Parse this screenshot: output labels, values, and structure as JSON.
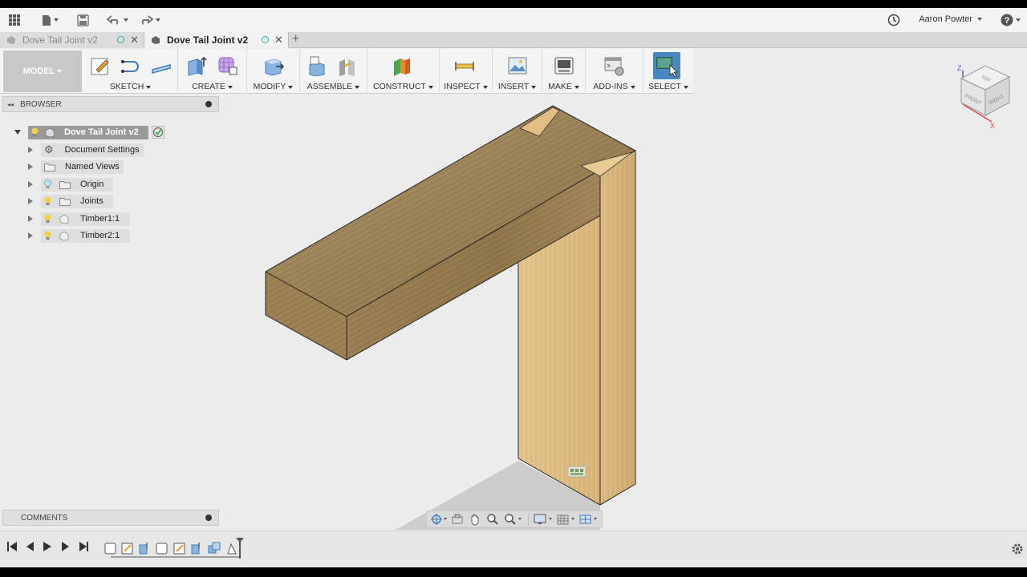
{
  "topbar": {
    "user_name": "Aaron Powter",
    "icons": [
      "grid-menu-icon",
      "file-icon",
      "save-icon",
      "undo-icon",
      "redo-icon",
      "clock-icon",
      "help-icon"
    ]
  },
  "tabs": [
    {
      "label": "Dove Tail Joint v2",
      "active": false
    },
    {
      "label": "Dove Tail Joint v2",
      "active": true
    }
  ],
  "toolbar": {
    "workspace": "MODEL",
    "groups": [
      "SKETCH",
      "CREATE",
      "MODIFY",
      "ASSEMBLE",
      "CONSTRUCT",
      "INSPECT",
      "INSERT",
      "MAKE",
      "ADD-INS",
      "SELECT"
    ]
  },
  "browser": {
    "title": "BROWSER",
    "root": "Dove Tail Joint v2",
    "items": [
      {
        "label": "Document Settings",
        "icon": "gear-icon"
      },
      {
        "label": "Named Views",
        "icon": "folder-icon"
      },
      {
        "label": "Origin",
        "icon": "folder-icon"
      },
      {
        "label": "Joints",
        "icon": "folder-icon"
      },
      {
        "label": "Timber1:1",
        "icon": "component-icon"
      },
      {
        "label": "Timber2:1",
        "icon": "component-icon"
      }
    ]
  },
  "comments": {
    "title": "COMMENTS"
  },
  "viewcube": {
    "top": "TOP",
    "front": "FRONT",
    "right": "RIGHT",
    "axis_z": "Z",
    "axis_x": "X"
  },
  "colors": {
    "accent_blue": "#3f7ec0",
    "select_blue": "#4a87c2",
    "wood_dark": "#8a7048",
    "wood_light": "#dcb980"
  }
}
